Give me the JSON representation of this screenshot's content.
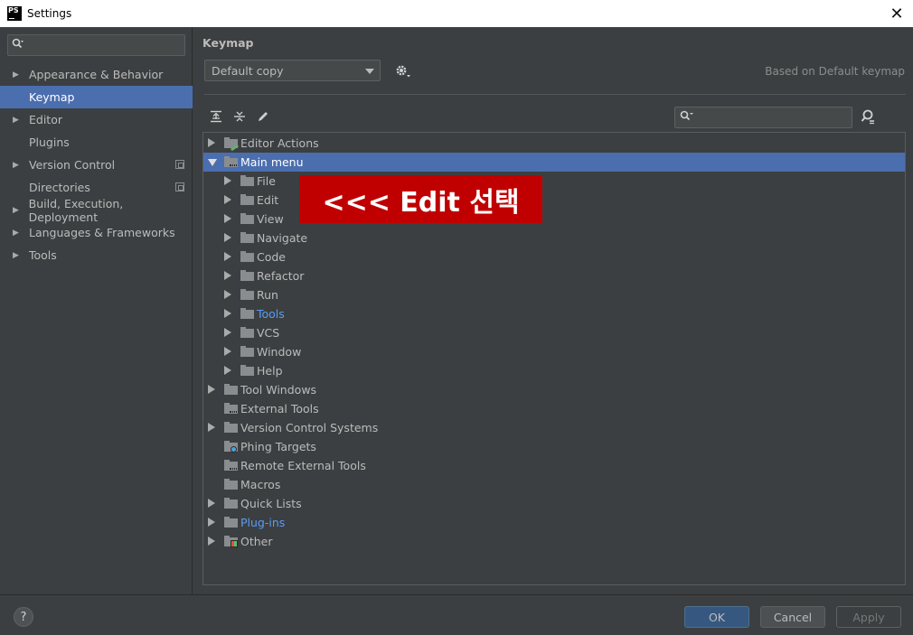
{
  "window": {
    "title": "Settings",
    "app_icon": "PS",
    "close_glyph": "✕"
  },
  "sidebar": {
    "search": {
      "placeholder": "",
      "value": ""
    },
    "items": [
      {
        "label": "Appearance & Behavior",
        "expandable": true,
        "selected": false,
        "config_icon": false
      },
      {
        "label": "Keymap",
        "expandable": false,
        "selected": true,
        "config_icon": false
      },
      {
        "label": "Editor",
        "expandable": true,
        "selected": false,
        "config_icon": false
      },
      {
        "label": "Plugins",
        "expandable": false,
        "selected": false,
        "config_icon": false
      },
      {
        "label": "Version Control",
        "expandable": true,
        "selected": false,
        "config_icon": true
      },
      {
        "label": "Directories",
        "expandable": false,
        "selected": false,
        "config_icon": true
      },
      {
        "label": "Build, Execution, Deployment",
        "expandable": true,
        "selected": false,
        "config_icon": false
      },
      {
        "label": "Languages & Frameworks",
        "expandable": true,
        "selected": false,
        "config_icon": false
      },
      {
        "label": "Tools",
        "expandable": true,
        "selected": false,
        "config_icon": false
      }
    ]
  },
  "main": {
    "heading": "Keymap",
    "keymap_select": "Default copy",
    "based_on": "Based on Default keymap",
    "toolbar": {
      "expand_all": "expand-all-icon",
      "collapse_all": "collapse-all-icon",
      "edit": "pencil-icon"
    },
    "tree": [
      {
        "label": "Editor Actions",
        "level": 0,
        "state": "collapsed",
        "icon": "folder-edit"
      },
      {
        "label": "Main menu",
        "level": 0,
        "state": "expanded",
        "icon": "folder-menu",
        "selected": true
      },
      {
        "label": "File",
        "level": 1,
        "state": "collapsed",
        "icon": "folder"
      },
      {
        "label": "Edit",
        "level": 1,
        "state": "collapsed",
        "icon": "folder"
      },
      {
        "label": "View",
        "level": 1,
        "state": "collapsed",
        "icon": "folder"
      },
      {
        "label": "Navigate",
        "level": 1,
        "state": "collapsed",
        "icon": "folder"
      },
      {
        "label": "Code",
        "level": 1,
        "state": "collapsed",
        "icon": "folder"
      },
      {
        "label": "Refactor",
        "level": 1,
        "state": "collapsed",
        "icon": "folder"
      },
      {
        "label": "Run",
        "level": 1,
        "state": "collapsed",
        "icon": "folder"
      },
      {
        "label": "Tools",
        "level": 1,
        "state": "collapsed",
        "icon": "folder",
        "link": true
      },
      {
        "label": "VCS",
        "level": 1,
        "state": "collapsed",
        "icon": "folder"
      },
      {
        "label": "Window",
        "level": 1,
        "state": "collapsed",
        "icon": "folder"
      },
      {
        "label": "Help",
        "level": 1,
        "state": "collapsed",
        "icon": "folder"
      },
      {
        "label": "Tool Windows",
        "level": 0,
        "state": "collapsed",
        "icon": "folder"
      },
      {
        "label": "External Tools",
        "level": 0,
        "state": "leaf",
        "icon": "folder-dots"
      },
      {
        "label": "Version Control Systems",
        "level": 0,
        "state": "collapsed",
        "icon": "folder"
      },
      {
        "label": "Phing Targets",
        "level": 0,
        "state": "leaf",
        "icon": "folder-gear"
      },
      {
        "label": "Remote External Tools",
        "level": 0,
        "state": "leaf",
        "icon": "folder-dots"
      },
      {
        "label": "Macros",
        "level": 0,
        "state": "leaf",
        "icon": "folder"
      },
      {
        "label": "Quick Lists",
        "level": 0,
        "state": "collapsed",
        "icon": "folder"
      },
      {
        "label": "Plug-ins",
        "level": 0,
        "state": "collapsed",
        "icon": "folder",
        "link": true
      },
      {
        "label": "Other",
        "level": 0,
        "state": "collapsed",
        "icon": "folder-grid"
      }
    ],
    "annotation": "<<< Edit 선택"
  },
  "footer": {
    "help": "?",
    "ok": "OK",
    "cancel": "Cancel",
    "apply": "Apply"
  },
  "colors": {
    "selection": "#4b6eaf",
    "link": "#589df6",
    "annotation_bg": "#c00000",
    "ok_button": "#365880"
  }
}
